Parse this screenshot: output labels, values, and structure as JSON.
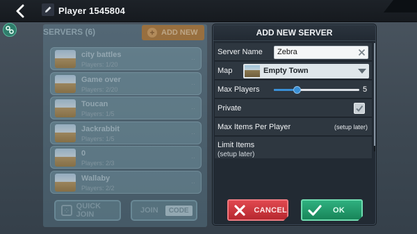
{
  "topbar": {
    "player_name": "Player 1545804"
  },
  "servers_panel": {
    "title": "SERVERS (6)",
    "add_new_label": "ADD NEW",
    "servers": [
      {
        "name": "city battles",
        "players": "Players: 1/20"
      },
      {
        "name": "Game over",
        "players": "Players: 2/20"
      },
      {
        "name": "Toucan",
        "players": "Players: 1/5"
      },
      {
        "name": "Jackrabbit",
        "players": "Players: 1/5"
      },
      {
        "name": "0",
        "players": "Players: 2/3"
      },
      {
        "name": "Wallaby",
        "players": "Players: 2/2"
      }
    ],
    "quick_join_label": "QUICK JOIN",
    "join_label": "JOIN",
    "code_label": "CODE"
  },
  "dialog": {
    "title": "ADD NEW SERVER",
    "server_name_label": "Server Name",
    "server_name_value": "Zebra",
    "map_label": "Map",
    "map_value": "Empty Town",
    "max_players_label": "Max Players",
    "max_players_value": "5",
    "max_players_slider_fraction": 0.27,
    "private_label": "Private",
    "private_checked": true,
    "max_items_label": "Max Items Per Player",
    "max_items_value": "(setup later)",
    "limit_items_label": "Limit Items",
    "limit_items_value": "(setup later)",
    "cancel_label": "CANCEL",
    "ok_label": "OK"
  },
  "colors": {
    "cancel": "#c9343b",
    "ok": "#22a06c",
    "slider": "#3a90d6",
    "add_new": "#b3752f"
  }
}
